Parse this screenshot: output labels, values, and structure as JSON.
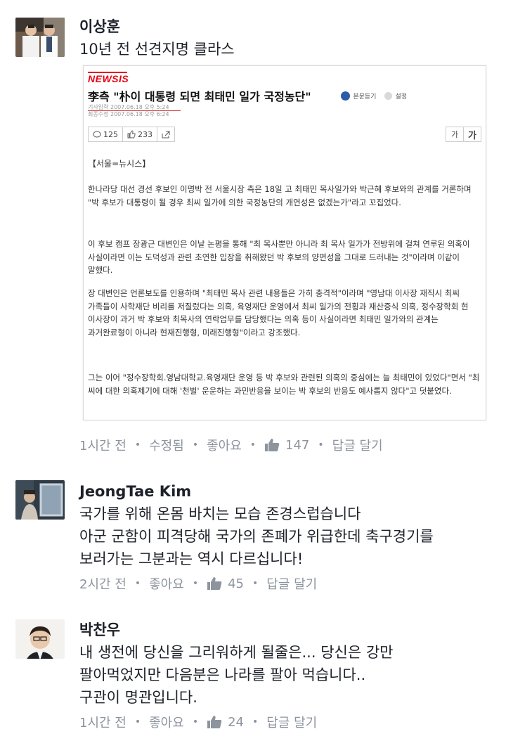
{
  "comments": [
    {
      "author": "이상훈",
      "text": "10년 전 선견지명 클라스",
      "meta": {
        "time": "1시간 전",
        "edited": "수정됨",
        "like": "좋아요",
        "like_count": "147",
        "reply": "답글 달기"
      }
    },
    {
      "author": "JeongTae Kim",
      "lines": [
        "국가를 위해 온몸 바치는 모습 존경스럽습니다",
        "아군 군함이 피격당해 국가의 존폐가 위급한데 축구경기를",
        "보러가는 그분과는 역시 다르십니다!"
      ],
      "meta": {
        "time": "2시간 전",
        "like": "좋아요",
        "like_count": "45",
        "reply": "답글 달기"
      }
    },
    {
      "author": "박찬우",
      "lines": [
        "내 생전에 당신을 그리워하게 될줄은... 당신은 강만",
        "팔아먹었지만 다음분은 나라를 팔아 먹습니다..",
        "구관이 명관입니다."
      ],
      "meta": {
        "time": "1시간 전",
        "like": "좋아요",
        "like_count": "24",
        "reply": "답글 달기"
      }
    }
  ],
  "article": {
    "logo": "NEWSIS",
    "headline": "李측 \"朴이 대통령 되면 최태민 일가 국정농단\"",
    "listen": "본문듣기",
    "settings": "설정",
    "date_input": "기사입력 2007.06.18 오후 5:24",
    "date_edit": "최종수정 2007.06.18 오후 6:24",
    "comments_count": "125",
    "likes_count": "233",
    "font_small": "가",
    "font_large": "가",
    "dateline": "【서울=뉴시스】",
    "paragraphs": [
      "한나라당 대선 경선 후보인 이명박 전 서울시장 측은 18일 고 최태민 목사일가와 박근혜 후보와의 관계를 거론하며 \"박 후보가 대통령이 될 경우 최씨 일가에 의한 국정농단의 개연성은 없겠는가\"라고 꼬집었다.",
      "이 후보 캠프 장광근 대변인은 이날 논평을 통해 \"최 목사뿐만 아니라 최 목사 일가가 전방위에 걸쳐 연루된 의혹이 사실이라면 이는 도덕성과 관련 초연한 입장을 취해왔던 박 후보의 양면성을 그대로 드러내는 것\"이라며 이같이 말했다.",
      "장 대변인은 언론보도를 인용하며 \"최태민 목사 관련 내용들은 가히 충격적\"이라며 \"영남대 이사장 재직시 최씨 가족들이 사학재단 비리를 저질렀다는 의혹, 육영재단 운영에서 최씨 일가의 전횡과 재산증식 의혹, 정수장학회 현 이사장이 과거 박 후보와 최목사의 연락업무를 담당했다는 의혹 등이 사실이라면 최태민 일가와의 관계는 과거완료형이 아니라 현재진행형, 미래진행형\"이라고 강조했다.",
      "그는 이어 \"정수장학회.영남대학교.육영재단 운영 등 박 후보와 관련된 의혹의 중심에는 늘 최태민이 있었다\"면서 \"최 씨에 대한 의혹제기에 대해 '천벌' 운운하는 과민반응을 보이는 박 후보의 반응도 예사롭지 않다\"고 덧붙였다."
    ]
  },
  "colors": {
    "text": "#1d2129",
    "meta": "#8d949e",
    "news_red": "#e60012"
  }
}
